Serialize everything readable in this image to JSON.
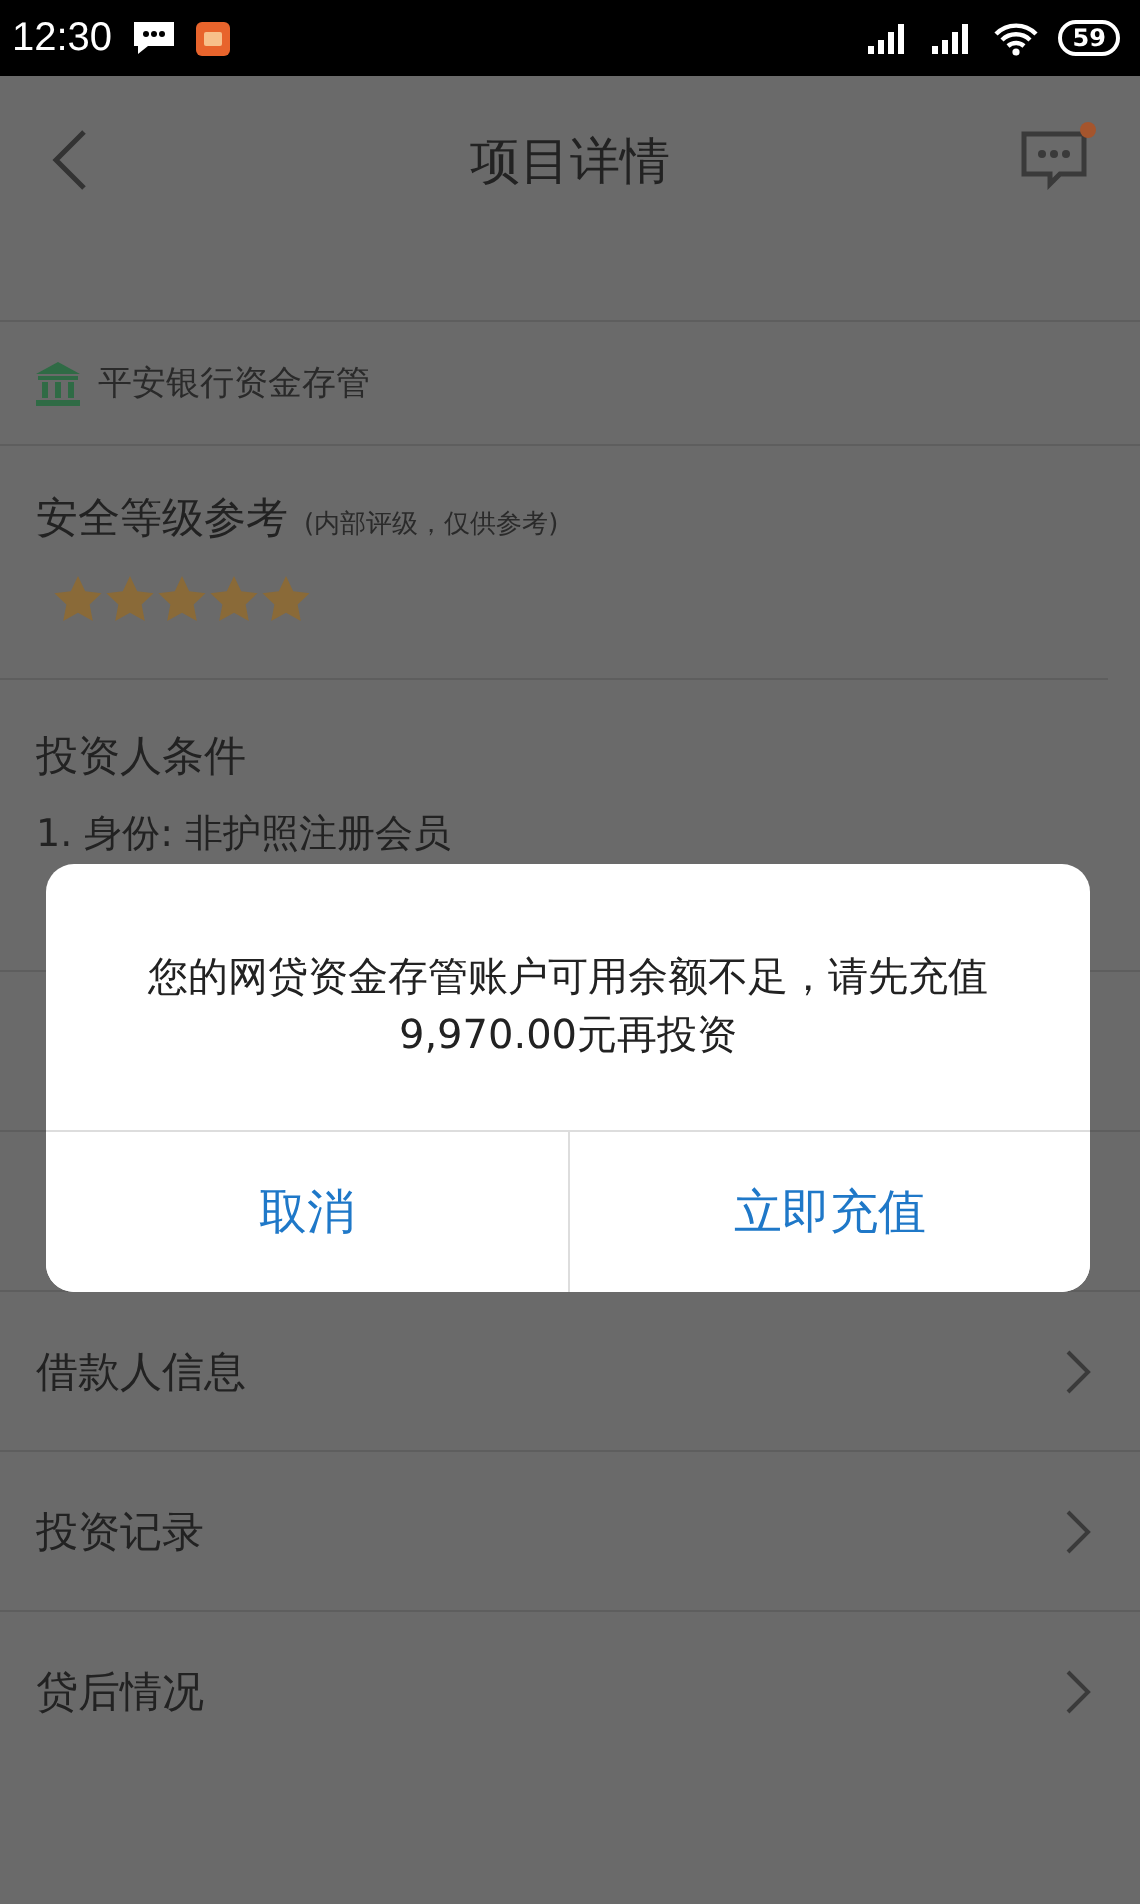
{
  "status_bar": {
    "time": "12:30",
    "battery": "59"
  },
  "header": {
    "title": "项目详情",
    "unread": true
  },
  "custody": {
    "label": "平安银行资金存管"
  },
  "rating": {
    "title": "安全等级参考",
    "note": "(内部评级，仅供参考)",
    "stars": 5
  },
  "investor_conditions": {
    "title": "投资人条件",
    "items": [
      "1. 身份: 非护照注册会员"
    ]
  },
  "menu": [
    {
      "label": "借款人信息"
    },
    {
      "label": "投资记录"
    },
    {
      "label": "贷后情况"
    }
  ],
  "dialog": {
    "message": "您的网贷资金存管账户可用余额不足，请先充值9,970.00元再投资",
    "buttons": [
      {
        "label": "取消"
      },
      {
        "label": "立即充值"
      }
    ]
  }
}
